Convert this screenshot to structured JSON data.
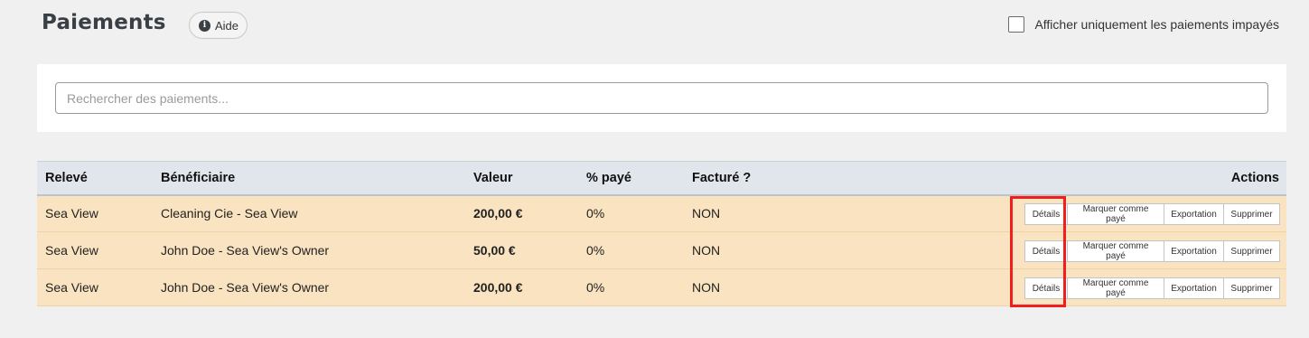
{
  "header": {
    "title": "Paiements",
    "help_label": "Aide",
    "help_icon_glyph": "i",
    "unpaid_filter_label": "Afficher uniquement les paiements impayés"
  },
  "search": {
    "placeholder": "Rechercher des paiements...",
    "value": ""
  },
  "table": {
    "headers": {
      "statement": "Relevé",
      "beneficiary": "Bénéficiaire",
      "value": "Valeur",
      "paid_percent": "% payé",
      "invoiced": "Facturé ?",
      "actions": "Actions"
    },
    "rows": [
      {
        "statement": "Sea View",
        "beneficiary": "Cleaning Cie - Sea View",
        "value": "200,00 €",
        "paid_percent": "0%",
        "invoiced": "NON"
      },
      {
        "statement": "Sea View",
        "beneficiary": "John Doe - Sea View's Owner",
        "value": "50,00 €",
        "paid_percent": "0%",
        "invoiced": "NON"
      },
      {
        "statement": "Sea View",
        "beneficiary": "John Doe - Sea View's Owner",
        "value": "200,00 €",
        "paid_percent": "0%",
        "invoiced": "NON"
      }
    ],
    "action_labels": {
      "details": "Détails",
      "mark_paid": "Marquer comme payé",
      "export": "Exportation",
      "delete": "Supprimer"
    }
  },
  "colors": {
    "row_background": "#fae3c0",
    "header_background": "#e0e6eb",
    "highlight": "#f21d1d"
  }
}
